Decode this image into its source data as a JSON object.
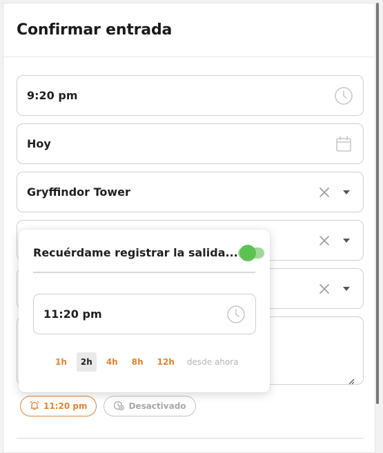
{
  "dialog": {
    "title": "Confirmar entrada"
  },
  "fields": {
    "time": {
      "value": "9:20 pm",
      "icon": "clock-icon"
    },
    "date": {
      "value": "Hoy",
      "icon": "calendar-icon"
    },
    "location": {
      "value": "Gryffindor Tower"
    },
    "select2": {
      "value": ""
    },
    "select3": {
      "value": ""
    },
    "notes": {
      "value": ""
    }
  },
  "reminder": {
    "title": "Recuérdame registrar la salida...",
    "enabled": true,
    "time_value": "11:20 pm",
    "quick_options": [
      "1h",
      "2h",
      "4h",
      "8h",
      "12h"
    ],
    "selected_option": "2h",
    "suffix": "desde ahora"
  },
  "chips": {
    "reminder_chip": {
      "label": "11:20 pm",
      "icon": "bell-icon"
    },
    "status_chip": {
      "label": "Desactivado",
      "icon": "timer-off-icon"
    }
  },
  "colors": {
    "accent_orange": "#e8812f",
    "toggle_green": "#5cc352",
    "border": "#cfcfcf"
  }
}
